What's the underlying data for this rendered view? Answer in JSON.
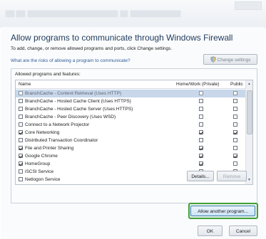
{
  "dialog": {
    "heading": "Allow programs to communicate through Windows Firewall",
    "subtext": "To add, change, or remove allowed programs and ports, click Change settings.",
    "risks_link": "What are the risks of allowing a program to communicate?",
    "change_settings_label": "Change settings"
  },
  "programs": {
    "group_label": "Allowed programs and features:",
    "columns": {
      "name": "Name",
      "home": "Home/Work (Private)",
      "public": "Public"
    },
    "rows": [
      {
        "name": "BranchCache - Content Retrieval (Uses HTTP)",
        "enabled": false,
        "home": false,
        "public": false,
        "selected": true
      },
      {
        "name": "BranchCache - Hosted Cache Client (Uses HTTPS)",
        "enabled": false,
        "home": false,
        "public": false,
        "selected": false
      },
      {
        "name": "BranchCache - Hosted Cache Server (Uses HTTPS)",
        "enabled": false,
        "home": false,
        "public": false,
        "selected": false
      },
      {
        "name": "BranchCache - Peer Discovery (Uses WSD)",
        "enabled": false,
        "home": false,
        "public": false,
        "selected": false
      },
      {
        "name": "Connect to a Network Projector",
        "enabled": false,
        "home": false,
        "public": false,
        "selected": false
      },
      {
        "name": "Core Networking",
        "enabled": true,
        "home": true,
        "public": true,
        "selected": false
      },
      {
        "name": "Distributed Transaction Coordinator",
        "enabled": false,
        "home": false,
        "public": false,
        "selected": false
      },
      {
        "name": "File and Printer Sharing",
        "enabled": true,
        "home": true,
        "public": false,
        "selected": false
      },
      {
        "name": "Google Chrome",
        "enabled": true,
        "home": true,
        "public": true,
        "selected": false
      },
      {
        "name": "HomeGroup",
        "enabled": true,
        "home": true,
        "public": false,
        "selected": false
      },
      {
        "name": "iSCSI Service",
        "enabled": false,
        "home": false,
        "public": false,
        "selected": false
      },
      {
        "name": "Netlogon Service",
        "enabled": false,
        "home": false,
        "public": false,
        "selected": false
      }
    ],
    "details_label": "Details...",
    "remove_label": "Remove"
  },
  "buttons": {
    "allow_another": "Allow another program...",
    "ok": "OK",
    "cancel": "Cancel"
  },
  "colors": {
    "highlight_border": "#41a03a",
    "selection": "#c8d7ea",
    "heading": "#1e3a5c"
  }
}
